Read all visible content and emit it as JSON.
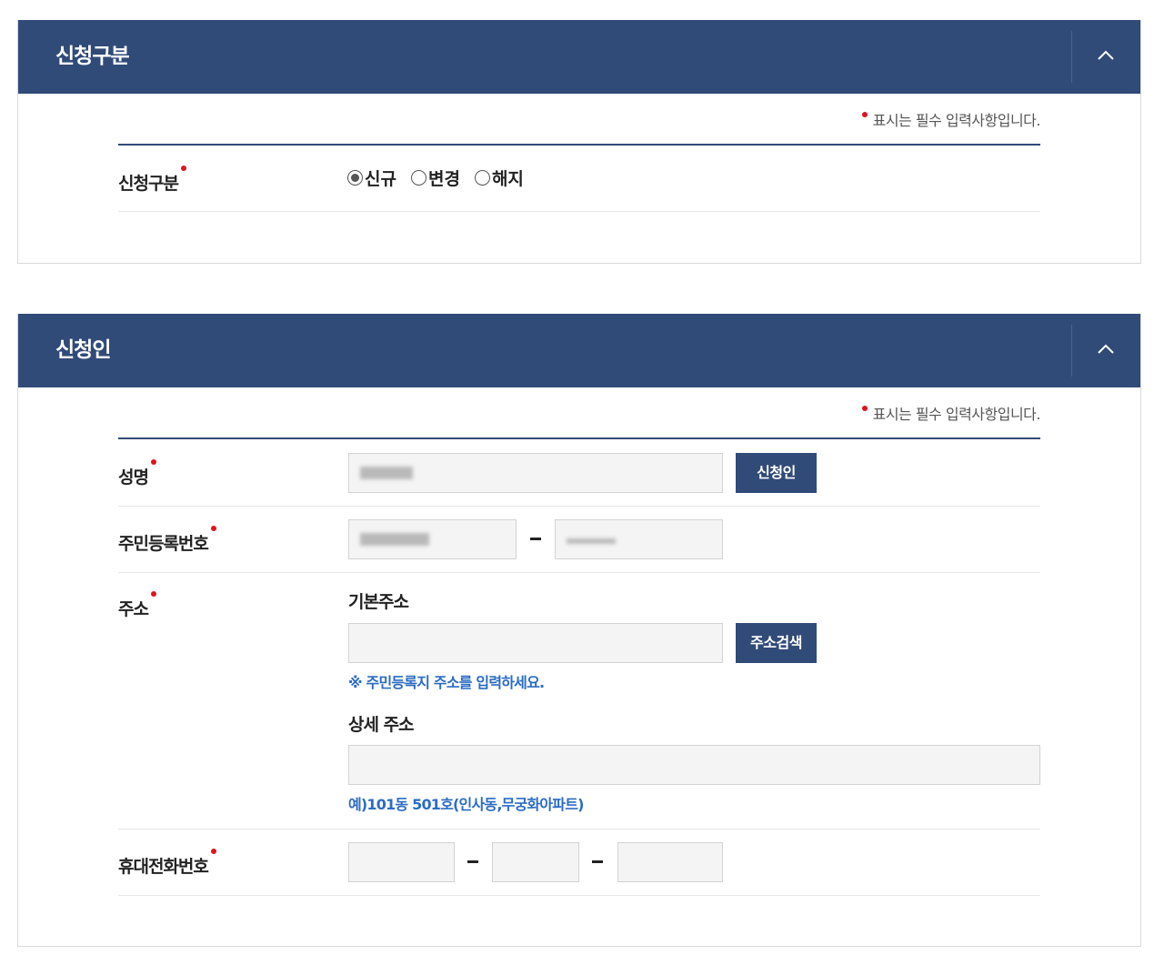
{
  "required_note": "표시는 필수 입력사항입니다.",
  "section1": {
    "title": "신청구분",
    "field_label": "신청구분",
    "options": [
      {
        "label": "신규",
        "checked": true
      },
      {
        "label": "변경",
        "checked": false
      },
      {
        "label": "해지",
        "checked": false
      }
    ]
  },
  "section2": {
    "title": "신청인",
    "name_label": "성명",
    "name_button": "신청인",
    "rrn_label": "주민등록번호",
    "address_label": "주소",
    "basic_address_label": "기본주소",
    "address_search_button": "주소검색",
    "address_hint": "※ 주민등록지 주소를 입력하세요.",
    "detail_address_label": "상세 주소",
    "detail_hint": "예)101동 501호(인사동,무궁화아파트)",
    "phone_label": "휴대전화번호"
  },
  "colors": {
    "header_bg": "#314b78",
    "required_dot": "#e0121e",
    "hint_text": "#2b6cc4"
  }
}
